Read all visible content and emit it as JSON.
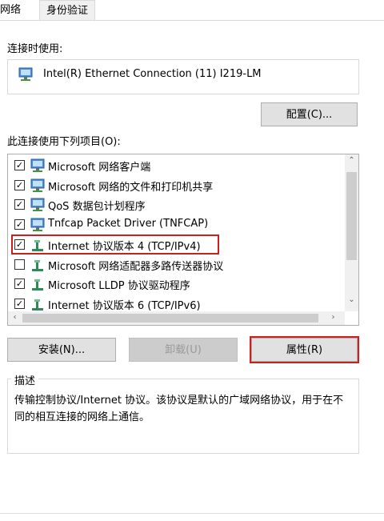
{
  "tabs": [
    {
      "label": "网络"
    },
    {
      "label": "身份验证"
    }
  ],
  "connect_label": "连接时使用:",
  "adapter_name": "Intel(R) Ethernet Connection (11) I219-LM",
  "configure_button": "配置(C)...",
  "items_label": "此连接使用下列项目(O):",
  "items": [
    {
      "label": "Microsoft 网络客户端",
      "checked": true,
      "icon": "network-client-icon"
    },
    {
      "label": "Microsoft 网络的文件和打印机共享",
      "checked": true,
      "icon": "network-service-icon"
    },
    {
      "label": "QoS 数据包计划程序",
      "checked": true,
      "icon": "network-service-icon"
    },
    {
      "label": "Tnfcap Packet Driver (TNFCAP)",
      "checked": true,
      "icon": "network-service-icon"
    },
    {
      "label": "Internet 协议版本 4 (TCP/IPv4)",
      "checked": true,
      "icon": "protocol-icon",
      "highlighted": true
    },
    {
      "label": "Microsoft 网络适配器多路传送器协议",
      "checked": false,
      "icon": "protocol-icon"
    },
    {
      "label": "Microsoft LLDP 协议驱动程序",
      "checked": true,
      "icon": "protocol-icon"
    },
    {
      "label": "Internet 协议版本 6 (TCP/IPv6)",
      "checked": true,
      "icon": "protocol-icon"
    }
  ],
  "buttons": {
    "install": "安装(N)...",
    "uninstall": "卸载(U)",
    "properties": "属性(R)"
  },
  "description_title": "描述",
  "description_text": "传输控制协议/Internet 协议。该协议是默认的广域网络协议，用于在不同的相互连接的网络上通信。",
  "colors": {
    "highlight": "#cc1f1f",
    "window": "#ffffff",
    "button": "#e1e1e1"
  }
}
